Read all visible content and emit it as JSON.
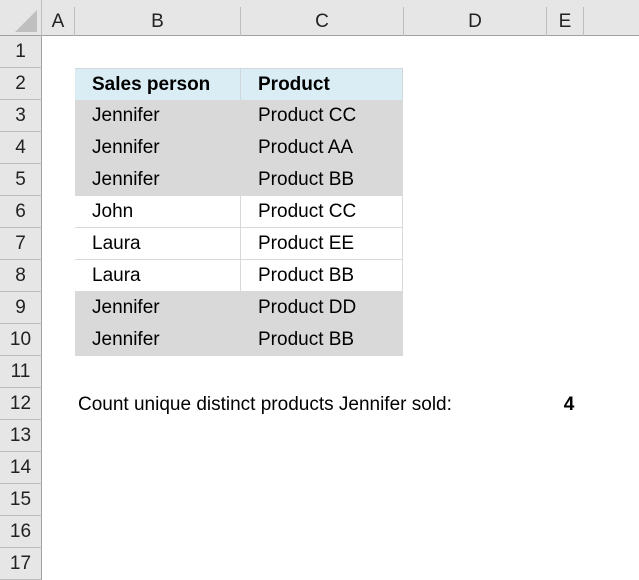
{
  "spreadsheet": {
    "columns": [
      "A",
      "B",
      "C",
      "D",
      "E"
    ],
    "rows": [
      "1",
      "2",
      "3",
      "4",
      "5",
      "6",
      "7",
      "8",
      "9",
      "10",
      "11",
      "12",
      "13",
      "14",
      "15",
      "16",
      "17"
    ],
    "table": {
      "headers": [
        "Sales person",
        "Product"
      ],
      "rows": [
        {
          "sales_person": "Jennifer",
          "product": "Product CC",
          "highlight": true
        },
        {
          "sales_person": "Jennifer",
          "product": "Product AA",
          "highlight": true
        },
        {
          "sales_person": "Jennifer",
          "product": "Product BB",
          "highlight": true
        },
        {
          "sales_person": "John",
          "product": "Product CC",
          "highlight": false
        },
        {
          "sales_person": "Laura",
          "product": "Product EE",
          "highlight": false
        },
        {
          "sales_person": "Laura",
          "product": "Product BB",
          "highlight": false
        },
        {
          "sales_person": "Jennifer",
          "product": "Product DD",
          "highlight": true
        },
        {
          "sales_person": "Jennifer",
          "product": "Product BB",
          "highlight": true
        }
      ]
    },
    "result": {
      "label": "Count unique distinct products  Jennifer sold:",
      "value": "4"
    },
    "colors": {
      "header_fill": "#daedf4",
      "highlight_fill": "#d9d9d9",
      "grid_header_bg": "#e6e6e6"
    }
  }
}
